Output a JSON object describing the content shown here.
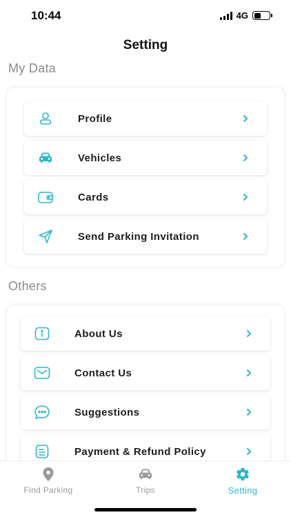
{
  "status": {
    "time": "10:44",
    "network": "4G",
    "battery_level": 0.45
  },
  "header": {
    "title": "Setting"
  },
  "my_data": {
    "heading": "My Data",
    "items": [
      {
        "label": "Profile",
        "icon": "user-icon"
      },
      {
        "label": "Vehicles",
        "icon": "car-icon"
      },
      {
        "label": "Cards",
        "icon": "wallet-icon"
      },
      {
        "label": "Send Parking Invitation",
        "icon": "send-icon"
      }
    ]
  },
  "others": {
    "heading": "Others",
    "items": [
      {
        "label": "About Us",
        "icon": "info-icon"
      },
      {
        "label": "Contact Us",
        "icon": "mail-icon"
      },
      {
        "label": "Suggestions",
        "icon": "chat-icon"
      },
      {
        "label": "Payment & Refund Policy",
        "icon": "document-icon"
      }
    ]
  },
  "tabs": [
    {
      "label": "Find Parking",
      "icon": "location-pin-icon",
      "active": false
    },
    {
      "label": "Trips",
      "icon": "car-icon",
      "active": false
    },
    {
      "label": "Setting",
      "icon": "gear-icon",
      "active": true
    }
  ],
  "colors": {
    "accent": "#2cb6c7",
    "inactive": "#9a9a9a",
    "text": "#1c1c1c",
    "section_heading": "#8a8a8a"
  }
}
